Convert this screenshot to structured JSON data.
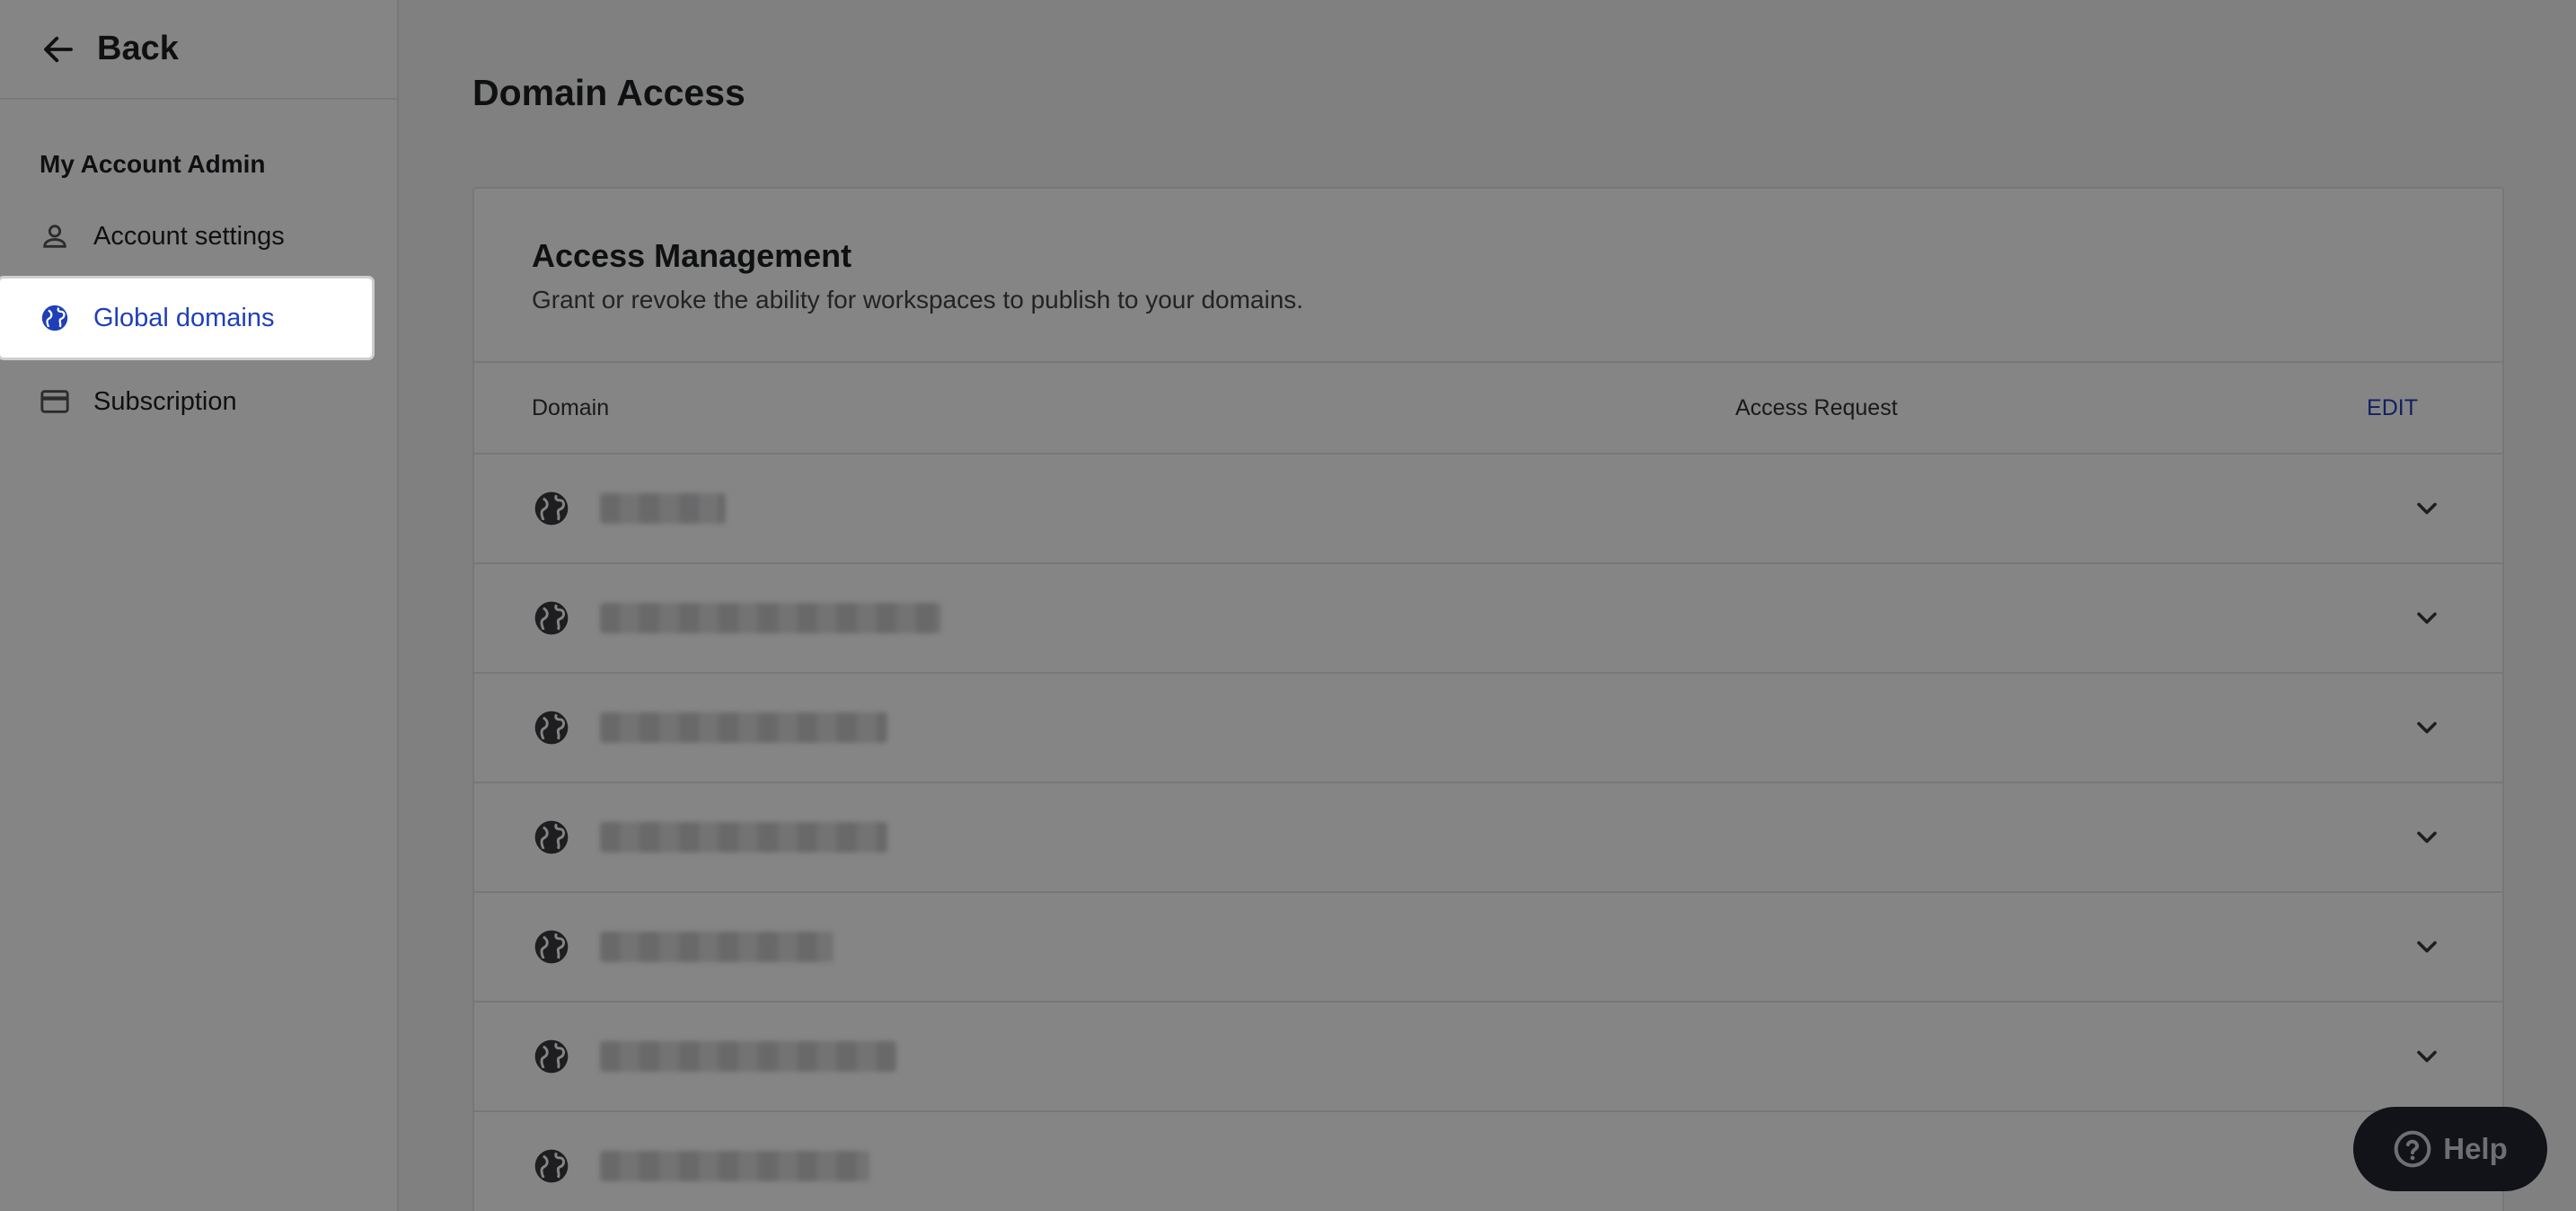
{
  "sidebar": {
    "back_label": "Back",
    "section_title": "My Account Admin",
    "items": [
      {
        "label": "Account settings",
        "icon": "person-icon"
      },
      {
        "label": "Global domains",
        "icon": "globe-icon",
        "active": true
      },
      {
        "label": "Subscription",
        "icon": "credit-card-icon"
      }
    ]
  },
  "main": {
    "page_title": "Domain Access",
    "card": {
      "title": "Access Management",
      "subtitle": "Grant or revoke the ability for workspaces to publish to your domains.",
      "columns": {
        "domain": "Domain",
        "access_request": "Access Request",
        "edit": "EDIT"
      },
      "rows_count_visible": 7
    }
  },
  "help_button": {
    "label": "Help"
  },
  "colors": {
    "accent": "#1f3fb8",
    "overlay": "rgba(0,0,0,0.48)",
    "help_bg": "#111318"
  }
}
